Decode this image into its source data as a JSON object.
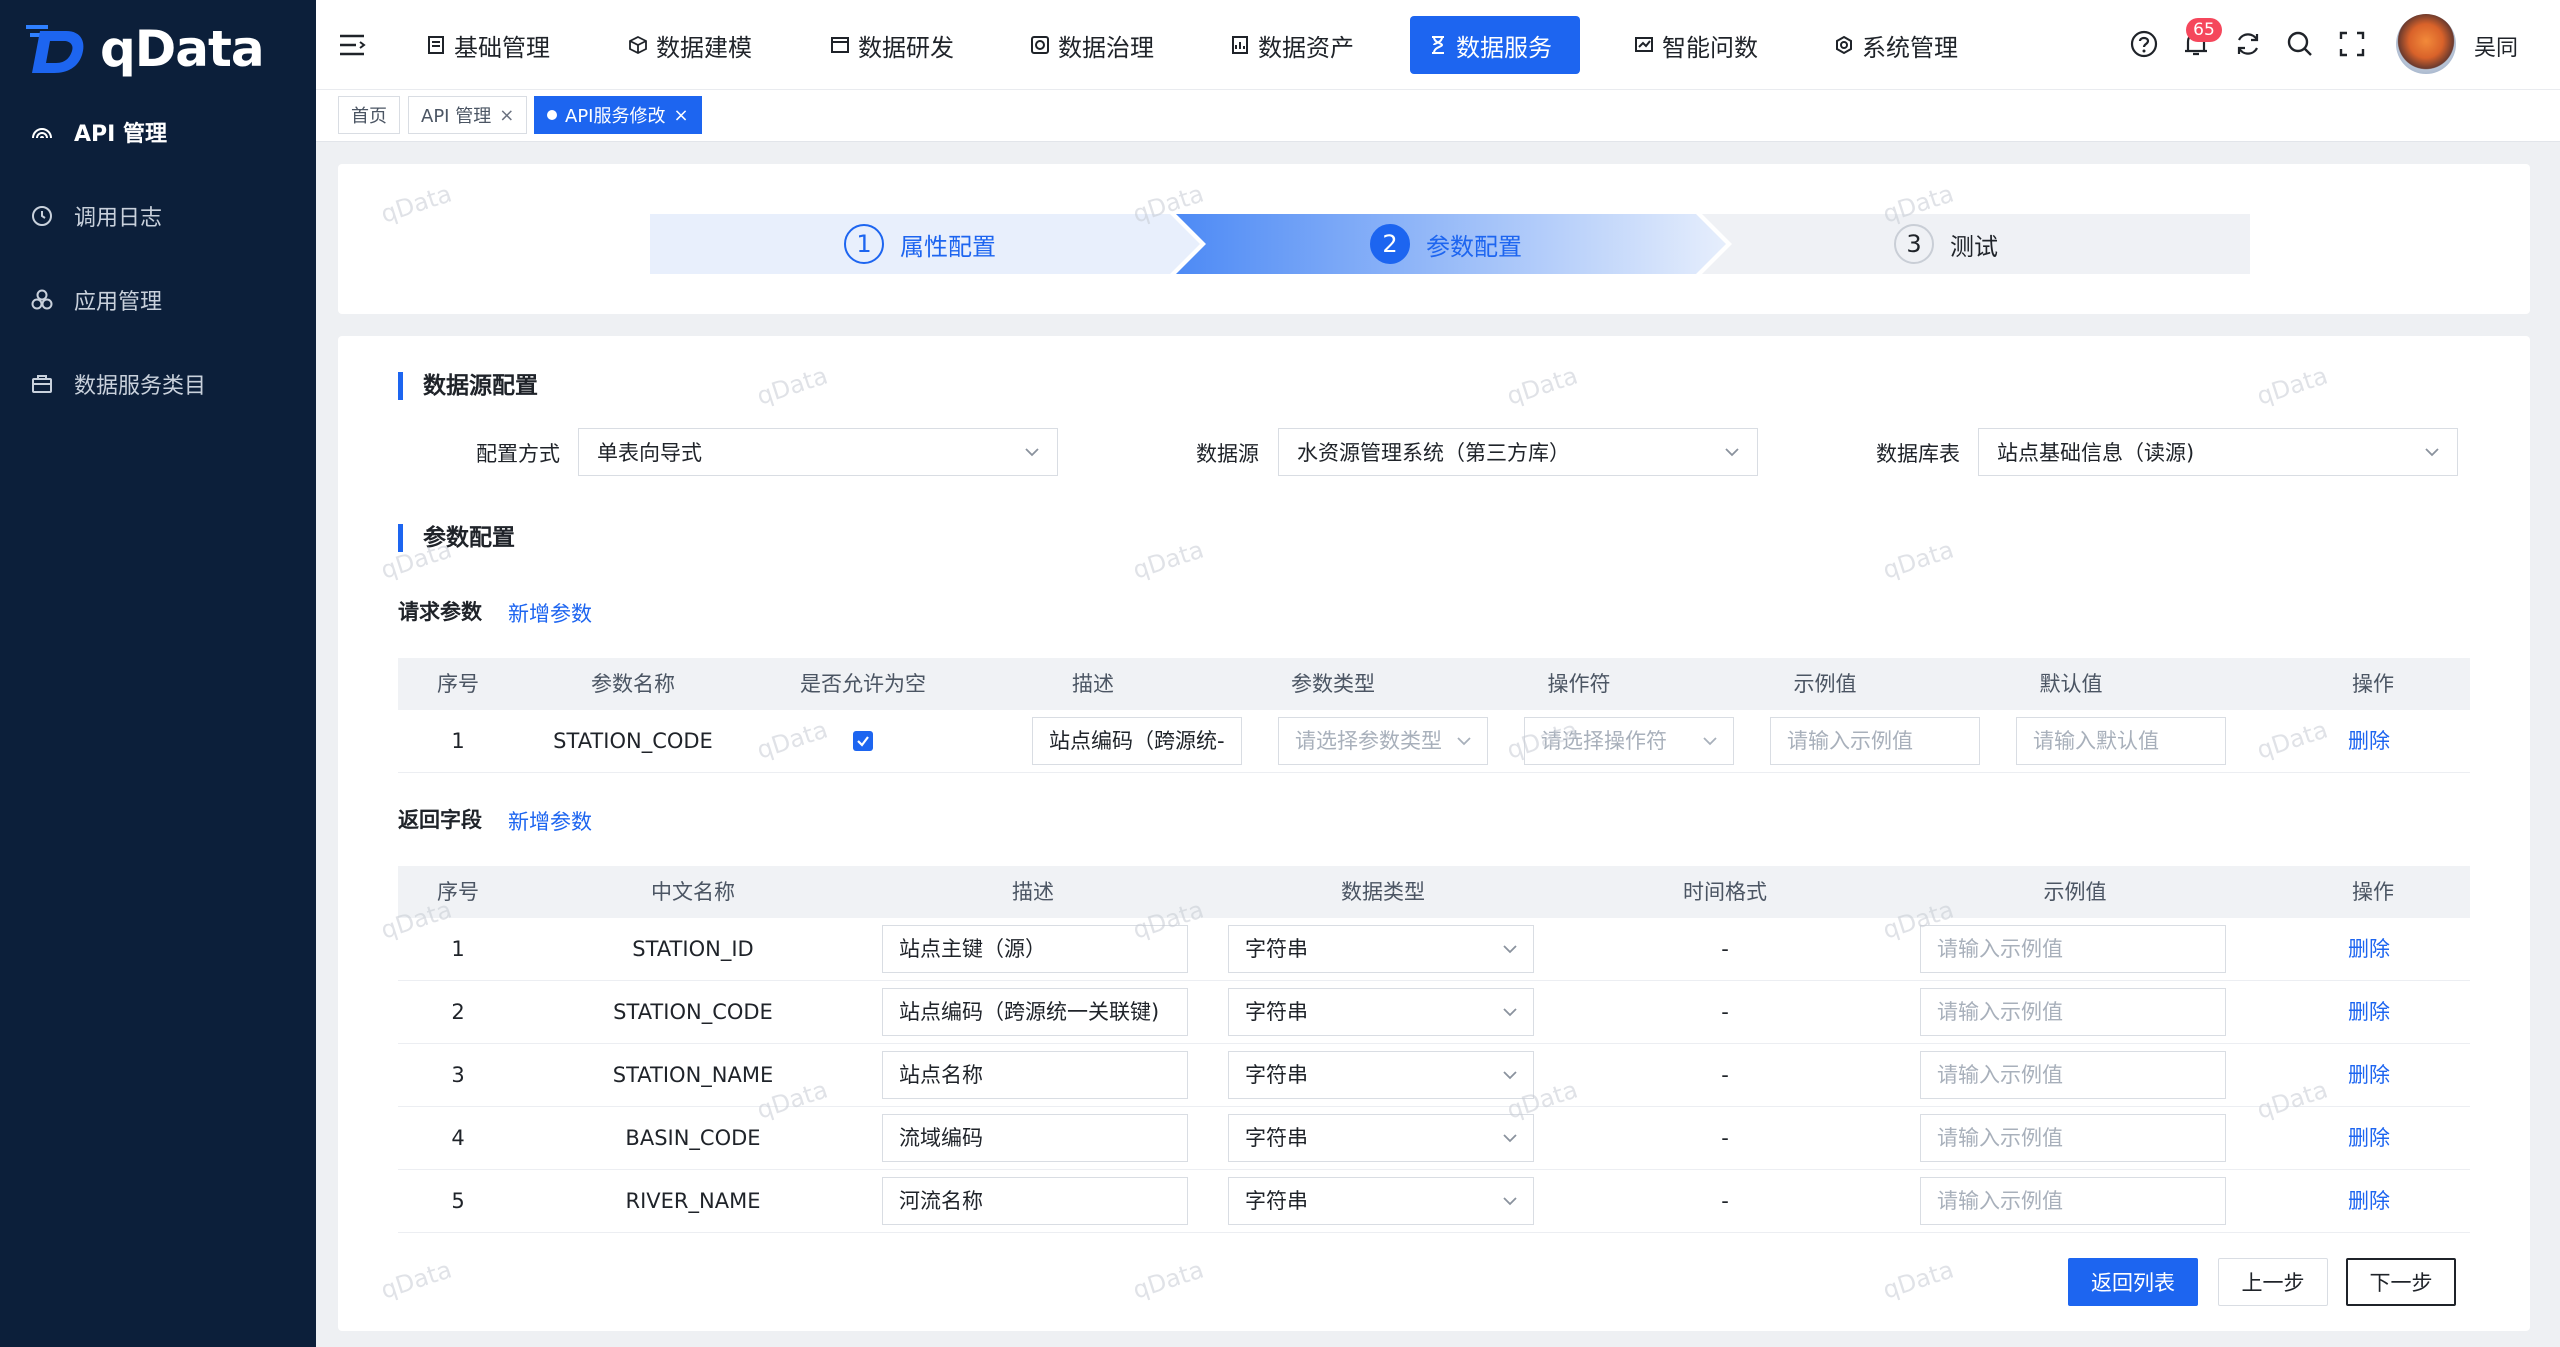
{
  "app": {
    "name": "qData"
  },
  "sidebar": {
    "items": [
      {
        "label": "API 管理",
        "icon": "api-icon"
      },
      {
        "label": "调用日志",
        "icon": "log-icon"
      },
      {
        "label": "应用管理",
        "icon": "apps-icon"
      },
      {
        "label": "数据服务类目",
        "icon": "category-icon"
      }
    ]
  },
  "header": {
    "nav": [
      {
        "label": "基础管理",
        "icon": "document-icon"
      },
      {
        "label": "数据建模",
        "icon": "cube-icon"
      },
      {
        "label": "数据研发",
        "icon": "window-icon"
      },
      {
        "label": "数据治理",
        "icon": "governance-icon"
      },
      {
        "label": "数据资产",
        "icon": "asset-icon"
      },
      {
        "label": "数据服务",
        "icon": "hourglass-icon"
      },
      {
        "label": "智能问数",
        "icon": "chart-icon"
      },
      {
        "label": "系统管理",
        "icon": "settings-icon"
      }
    ],
    "notifications": "65",
    "user": "吴同"
  },
  "tabs": [
    {
      "label": "首页"
    },
    {
      "label": "API 管理"
    },
    {
      "label": "API服务修改"
    }
  ],
  "steps": [
    {
      "num": "1",
      "label": "属性配置"
    },
    {
      "num": "2",
      "label": "参数配置"
    },
    {
      "num": "3",
      "label": "测试"
    }
  ],
  "datasource": {
    "title": "数据源配置",
    "config_label": "配置方式",
    "config_value": "单表向导式",
    "source_label": "数据源",
    "source_value": "水资源管理系统（第三方库）",
    "table_label": "数据库表",
    "table_value": "站点基础信息（读源)"
  },
  "params": {
    "title": "参数配置",
    "request_label": "请求参数",
    "add_label": "新增参数",
    "return_label": "返回字段"
  },
  "request_table": {
    "headers": [
      "序号",
      "参数名称",
      "是否允许为空",
      "描述",
      "参数类型",
      "操作符",
      "示例值",
      "默认值",
      "操作"
    ],
    "rows": [
      {
        "no": "1",
        "name": "STATION_CODE",
        "desc": "站点编码（跨源统-",
        "type_ph": "请选择参数类型",
        "op_ph": "请选择操作符",
        "example_ph": "请输入示例值",
        "default_ph": "请输入默认值",
        "action": "删除"
      }
    ]
  },
  "return_table": {
    "headers": [
      "序号",
      "中文名称",
      "描述",
      "数据类型",
      "时间格式",
      "示例值",
      "操作"
    ],
    "rows": [
      {
        "no": "1",
        "name": "STATION_ID",
        "desc": "站点主键（源）",
        "type": "字符串",
        "time": "-",
        "example_ph": "请输入示例值",
        "action": "删除"
      },
      {
        "no": "2",
        "name": "STATION_CODE",
        "desc": "站点编码（跨源统一关联键)",
        "type": "字符串",
        "time": "-",
        "example_ph": "请输入示例值",
        "action": "删除"
      },
      {
        "no": "3",
        "name": "STATION_NAME",
        "desc": "站点名称",
        "type": "字符串",
        "time": "-",
        "example_ph": "请输入示例值",
        "action": "删除"
      },
      {
        "no": "4",
        "name": "BASIN_CODE",
        "desc": "流域编码",
        "type": "字符串",
        "time": "-",
        "example_ph": "请输入示例值",
        "action": "删除"
      },
      {
        "no": "5",
        "name": "RIVER_NAME",
        "desc": "河流名称",
        "type": "字符串",
        "time": "-",
        "example_ph": "请输入示例值",
        "action": "删除"
      }
    ]
  },
  "buttons": {
    "back": "返回列表",
    "prev": "上一步",
    "next": "下一步"
  },
  "watermark": "qData",
  "colors": {
    "primary": "#1d65f0",
    "sidebar": "#0c1f3a",
    "badge": "#f5475c"
  }
}
